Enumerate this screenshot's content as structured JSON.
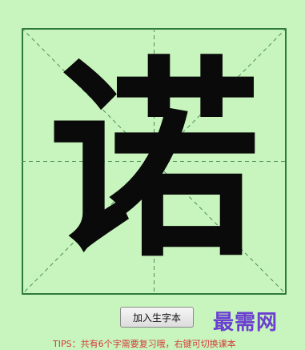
{
  "character": "诺",
  "add_button_label": "加入生字本",
  "watermark": "最需网",
  "tips": "TIPS：共有6个字需要复习哦，右键可切换课本",
  "colors": {
    "background": "#c8f5bd",
    "grid_border": "#2e7a3a",
    "grid_dashes": "#4c8f57",
    "glyph": "#0a0a0a",
    "tips": "#d53a3a",
    "watermark": "#6a3fd1"
  },
  "icons": [
    "tian-zi-ge-grid"
  ]
}
